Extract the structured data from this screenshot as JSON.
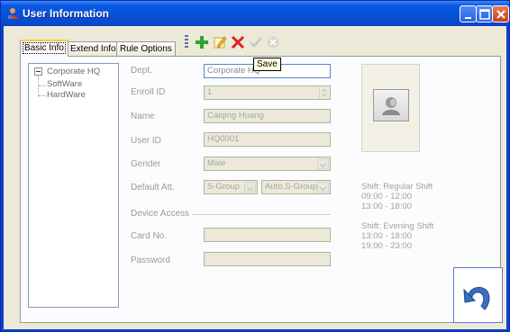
{
  "window": {
    "title": "User Information"
  },
  "tabs": [
    {
      "label": "Basic Info",
      "active": true
    },
    {
      "label": "Extend Info",
      "active": false
    },
    {
      "label": "Rule Options",
      "active": false
    }
  ],
  "toolbar": {
    "icons": [
      "add-icon",
      "edit-icon",
      "delete-icon",
      "confirm-icon",
      "cancel-icon"
    ],
    "tooltip": "Save"
  },
  "tree": {
    "root": "Corporate HQ",
    "children": [
      "SoftWare",
      "HardWare"
    ]
  },
  "form": {
    "dept_label": "Dept.",
    "dept_value": "Corporate HQ",
    "enroll_label": "Enroll ID",
    "enroll_value": "1",
    "name_label": "Name",
    "name_value": "Caiqing Huang",
    "userid_label": "User ID",
    "userid_value": "HQ0001",
    "gender_label": "Gender",
    "gender_value": "Male",
    "default_att_label": "Default Att.",
    "default_att_group": "S-Group",
    "default_att_auto": "Auto.S-Group",
    "device_access_label": "Device Access",
    "card_label": "Card No.",
    "card_value": "",
    "password_label": "Password",
    "password_value": ""
  },
  "shifts": [
    {
      "name": "Shift: Regular Shift",
      "times": [
        "09:00 - 12:00",
        "13:00 - 18:00"
      ]
    },
    {
      "name": "Shift: Evening Shift",
      "times": [
        "13:00 - 18:00",
        "19:00 - 23:00"
      ]
    }
  ],
  "colors": {
    "titlebar": "#0a59e6",
    "accent": "#ffc83c",
    "window_bg": "#ece9d8"
  }
}
